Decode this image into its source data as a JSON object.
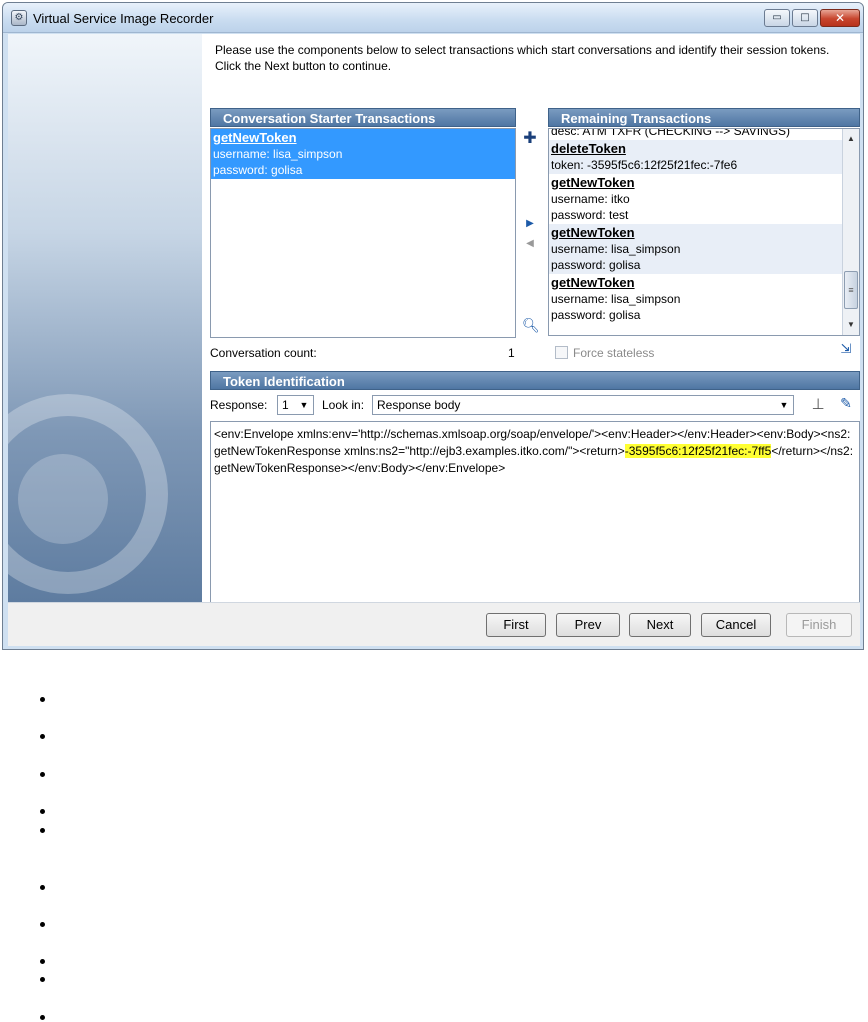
{
  "window": {
    "title": "Virtual Service Image Recorder",
    "controls": {
      "minimize": "▭",
      "maximize": "□",
      "close": "✕"
    }
  },
  "instructions": "Please use the components below to select transactions which start conversations and identify their session tokens.  Click the Next button to continue.",
  "starter": {
    "header": "Conversation Starter Transactions",
    "items": [
      {
        "op": "getNewToken",
        "lines": [
          "username: lisa_simpson",
          "password: golisa"
        ],
        "selected": true
      }
    ]
  },
  "remaining": {
    "header": "Remaining Transactions",
    "items": [
      {
        "op": "",
        "lines": [
          "desc: ATM TXFR (CHECKING --> SAVINGS)"
        ]
      },
      {
        "op": "deleteToken",
        "lines": [
          "token: -3595f5c6:12f25f21fec:-7fe6"
        ]
      },
      {
        "op": "getNewToken",
        "lines": [
          "username: itko",
          "password: test"
        ]
      },
      {
        "op": "getNewToken",
        "lines": [
          "username: lisa_simpson",
          "password: golisa"
        ]
      },
      {
        "op": "getNewToken",
        "lines": [
          "username: lisa_simpson",
          "password: golisa"
        ]
      }
    ]
  },
  "conversation": {
    "count_label": "Conversation count:",
    "count_value": "1"
  },
  "force_stateless": {
    "label": "Force stateless",
    "checked": false
  },
  "token": {
    "header": "Token Identification",
    "response_label": "Response:",
    "response_value": "1",
    "look_in_label": "Look in:",
    "look_in_value": "Response body",
    "body_before": "<env:Envelope xmlns:env='http://schemas.xmlsoap.org/soap/envelope/'><env:Header></env:Header><env:Body><ns2:getNewTokenResponse xmlns:ns2=\"http://ejb3.examples.itko.com/\"><return>",
    "body_highlight": "-3595f5c6:12f25f21fec:-7ff5",
    "body_after": "</return></ns2:getNewTokenResponse></env:Body></env:Envelope>"
  },
  "buttons": {
    "first": "First",
    "prev": "Prev",
    "next": "Next",
    "cancel": "Cancel",
    "finish": "Finish"
  },
  "icons": {
    "add": "plus-icon",
    "move_right": "arrow-right-icon",
    "move_left": "arrow-left-icon",
    "search": "magnifier-icon",
    "export": "export-icon",
    "stamp": "stamp-icon",
    "edit": "pencil-icon"
  },
  "colors": {
    "header": "#4f76a3",
    "selection": "#3399ff",
    "highlight": "#ffff33"
  }
}
